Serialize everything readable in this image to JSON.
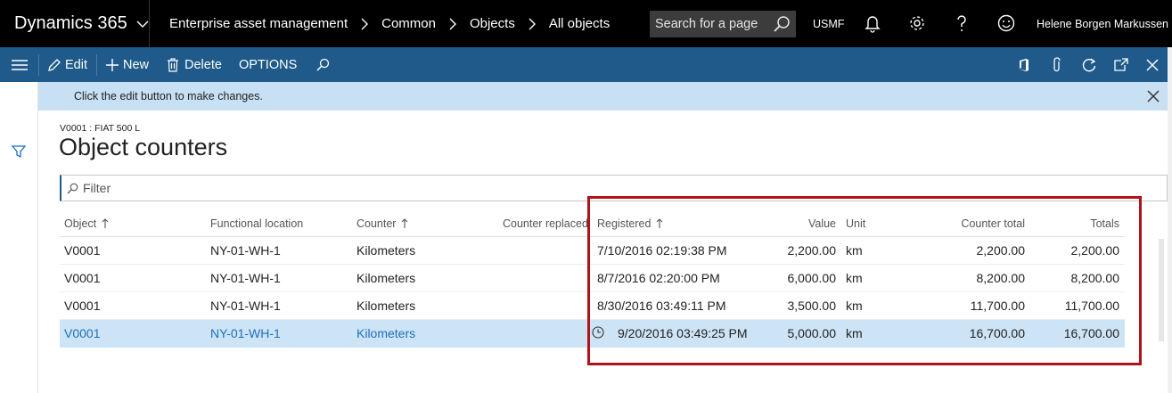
{
  "app": {
    "name": "Dynamics 365"
  },
  "breadcrumb": [
    "Enterprise asset management",
    "Common",
    "Objects",
    "All objects"
  ],
  "top_search": {
    "placeholder": "Search for a page"
  },
  "company": "USMF",
  "user": {
    "name": "Helene Borgen Markussen"
  },
  "actions": {
    "edit": "Edit",
    "new": "New",
    "delete": "Delete",
    "options": "OPTIONS"
  },
  "message": {
    "text": "Click the edit button to make changes."
  },
  "page": {
    "caption": "V0001 : FIAT 500 L",
    "title": "Object counters"
  },
  "filter": {
    "placeholder": "Filter"
  },
  "grid": {
    "columns": {
      "object": "Object",
      "functional_location": "Functional location",
      "counter": "Counter",
      "counter_replaced": "Counter replaced",
      "registered": "Registered",
      "value": "Value",
      "unit": "Unit",
      "counter_total": "Counter total",
      "totals": "Totals"
    },
    "rows": [
      {
        "object": "V0001",
        "functional_location": "NY-01-WH-1",
        "counter": "Kilometers",
        "registered": "7/10/2016 02:19:38 PM",
        "value": "2,200.00",
        "unit": "km",
        "counter_total": "2,200.00",
        "totals": "2,200.00"
      },
      {
        "object": "V0001",
        "functional_location": "NY-01-WH-1",
        "counter": "Kilometers",
        "registered": "8/7/2016 02:20:00 PM",
        "value": "6,000.00",
        "unit": "km",
        "counter_total": "8,200.00",
        "totals": "8,200.00"
      },
      {
        "object": "V0001",
        "functional_location": "NY-01-WH-1",
        "counter": "Kilometers",
        "registered": "8/30/2016 03:49:11 PM",
        "value": "3,500.00",
        "unit": "km",
        "counter_total": "11,700.00",
        "totals": "11,700.00"
      },
      {
        "object": "V0001",
        "functional_location": "NY-01-WH-1",
        "counter": "Kilometers",
        "registered": "9/20/2016 03:49:25 PM",
        "value": "5,000.00",
        "unit": "km",
        "counter_total": "16,700.00",
        "totals": "16,700.00"
      }
    ]
  },
  "colors": {
    "topbar": "#000000",
    "actionbar": "#1f5a8a",
    "messagebar": "#c7e0f4",
    "selected_row": "#cce4f6",
    "link": "#1f6fb7",
    "highlight": "#b0111a"
  }
}
